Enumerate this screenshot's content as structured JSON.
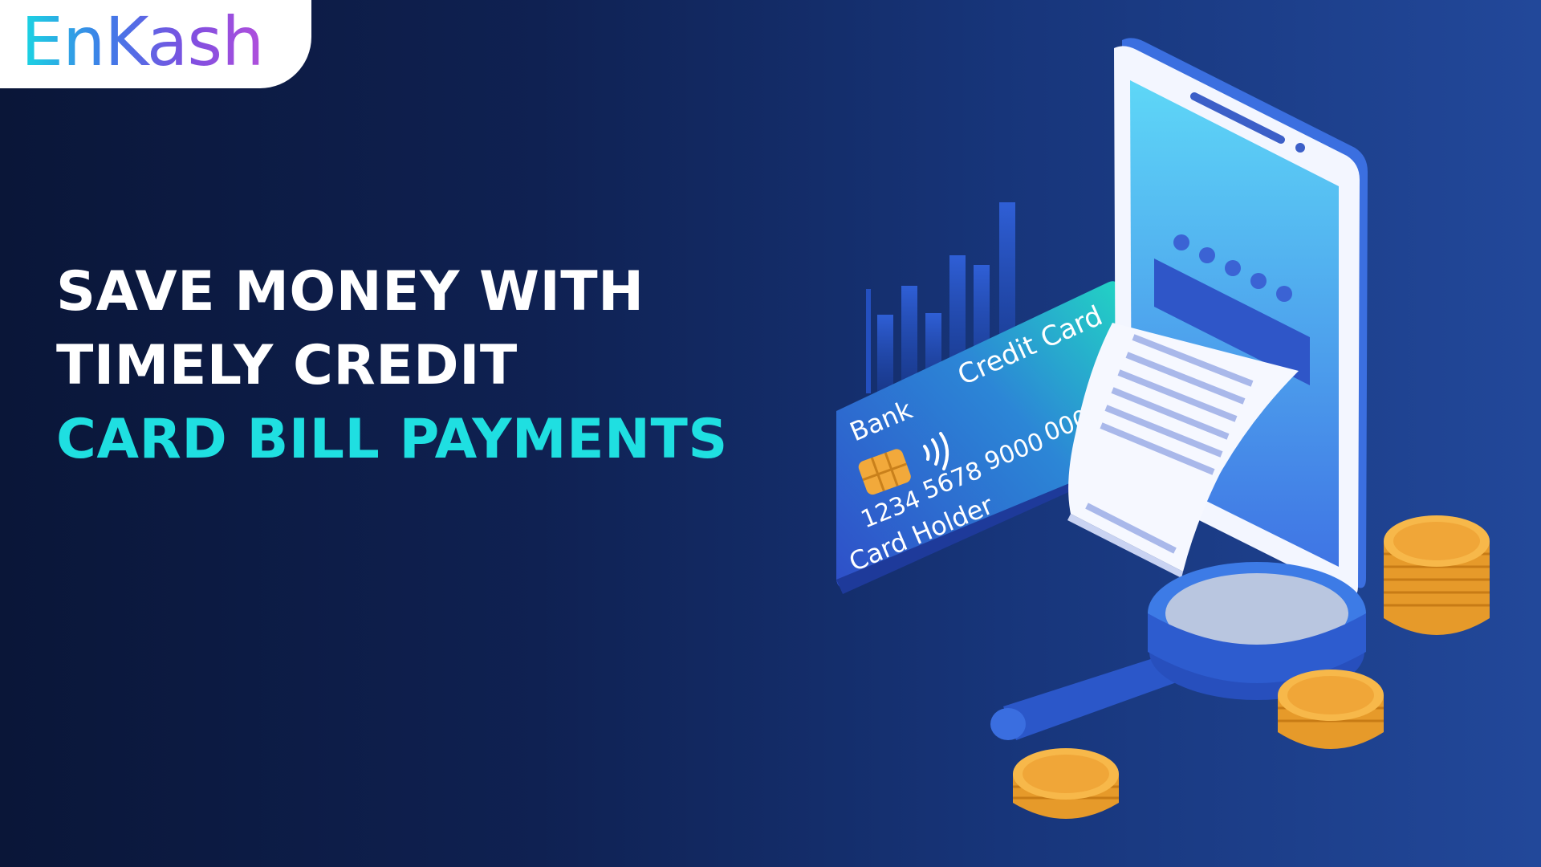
{
  "brand": {
    "name": "EnKash"
  },
  "headline": {
    "line1": "SAVE MONEY WITH",
    "line2": "TIMELY CREDIT",
    "line3": "CARD BILL PAYMENTS"
  },
  "card": {
    "bank": "Bank",
    "type": "Credit Card",
    "number_groups": [
      "1234",
      "5678",
      "9000",
      "000"
    ],
    "holder": "Card Holder"
  },
  "colors": {
    "background_dark": "#0a1638",
    "background_light": "#22489a",
    "accent_cyan": "#1fdfe1",
    "coin_gold": "#f2a93b",
    "phone_blue": "#4aa6f0"
  },
  "icons": [
    "enkash-logo",
    "bar-chart-icon",
    "credit-card-icon",
    "chip-icon",
    "contactless-icon",
    "smartphone-icon",
    "receipt-icon",
    "magnifying-glass-icon",
    "coin-stack-icon"
  ]
}
